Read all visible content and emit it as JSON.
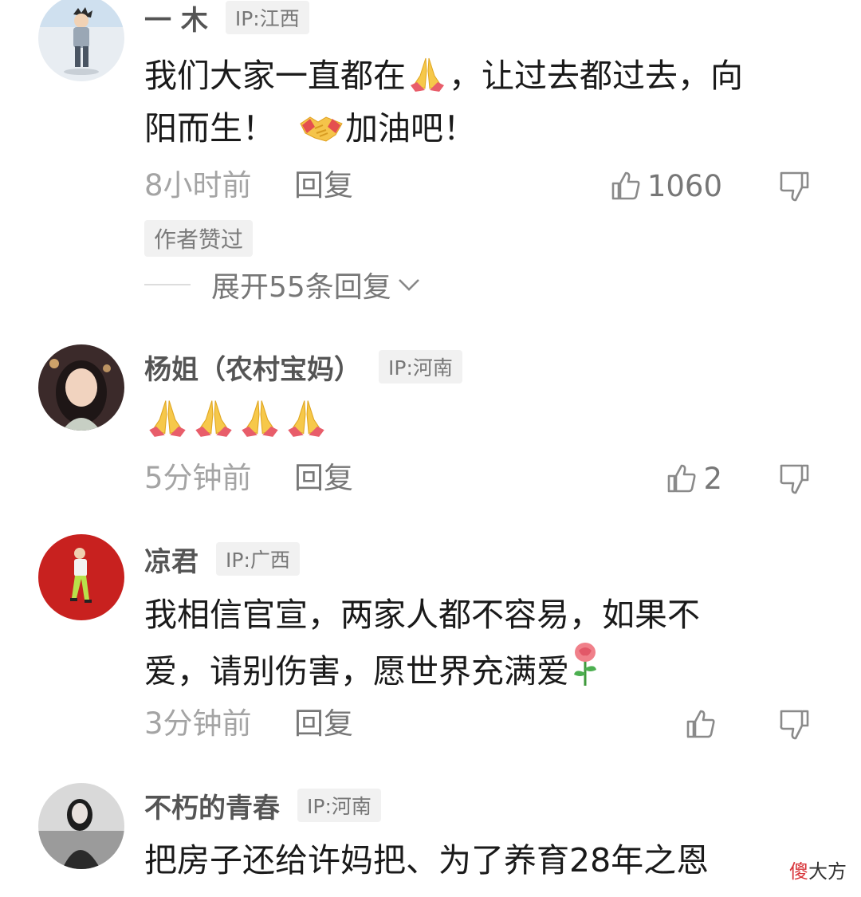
{
  "comments": [
    {
      "username": "一 木",
      "ip": "IP:江西",
      "text": {
        "line1_a": "我们大家一直都在",
        "line1_b": "，让过去都过去，向",
        "line2_a": "阳而生！",
        "line2_b": "加油吧！"
      },
      "emojis": [
        "folded-hands-icon",
        "handshake-icon"
      ],
      "time": "8小时前",
      "reply_label": "回复",
      "likes": "1060",
      "author_badge": "作者赞过",
      "expand_label": "展开55条回复"
    },
    {
      "username": "杨姐（农村宝妈）",
      "ip": "IP:河南",
      "emojis": [
        "folded-hands-icon",
        "folded-hands-icon",
        "folded-hands-icon",
        "folded-hands-icon"
      ],
      "time": "5分钟前",
      "reply_label": "回复",
      "likes": "2"
    },
    {
      "username": "凉君",
      "ip": "IP:广西",
      "text": {
        "line1": "我相信官宣，两家人都不容易，如果不",
        "line2": "爱，请别伤害，愿世界充满爱"
      },
      "emojis": [
        "rose-icon"
      ],
      "time": "3分钟前",
      "reply_label": "回复",
      "likes": ""
    },
    {
      "username": "不朽的青春",
      "ip": "IP:河南",
      "text": {
        "line1": "把房子还给许妈把、为了养育28年之恩"
      }
    }
  ],
  "watermark": {
    "first": "傻",
    "rest": "大方"
  },
  "colors": {
    "text": "#1a1a1a",
    "username": "#555555",
    "muted": "#a4a4a4",
    "badge_bg": "#f1f1f1",
    "watermark_accent": "#d8363b"
  }
}
